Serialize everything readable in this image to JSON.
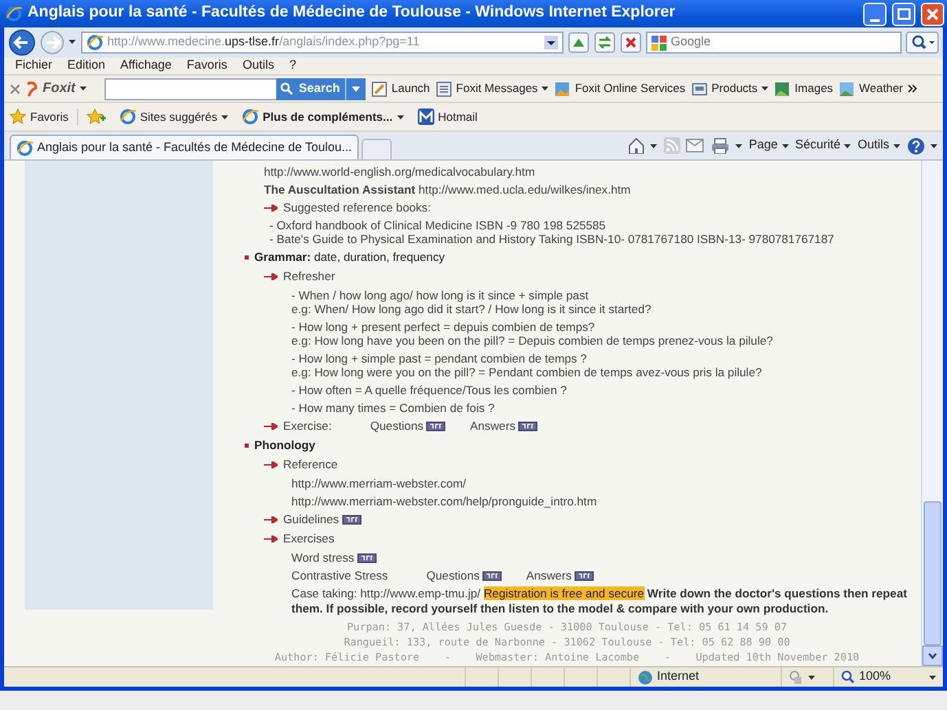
{
  "window": {
    "title": "Anglais pour la santé - Facultés de Médecine de Toulouse - Windows Internet Explorer"
  },
  "address": {
    "prefix": "http://www.medecine.",
    "host": "ups-tlse.fr",
    "path": "/anglais/index.php?pg=11"
  },
  "search": {
    "placeholder": "Google"
  },
  "menu": [
    "Fichier",
    "Edition",
    "Affichage",
    "Favoris",
    "Outils",
    "?"
  ],
  "foxit": {
    "brand": "Foxit",
    "button": "Search",
    "items": [
      {
        "label": "Launch",
        "dropdown": false
      },
      {
        "label": "Foxit Messages",
        "dropdown": true
      },
      {
        "label": "Foxit Online Services",
        "dropdown": false
      },
      {
        "label": "Products",
        "dropdown": true
      },
      {
        "label": "Images",
        "dropdown": false
      },
      {
        "label": "Weather",
        "dropdown": false
      }
    ]
  },
  "favorites": {
    "label": "Favoris",
    "items": [
      {
        "label": "Sites suggérés",
        "bold": false,
        "dropdown": true
      },
      {
        "label": "Plus de compléments...",
        "bold": true,
        "dropdown": true
      },
      {
        "label": "Hotmail",
        "bold": false,
        "dropdown": false
      }
    ]
  },
  "tabs": [
    {
      "label": "Anglais pour la santé - Facultés de Médecine de Toulou...",
      "selected": true
    }
  ],
  "commands": [
    "Page",
    "Sécurité",
    "Outils"
  ],
  "content": [
    {
      "kind": "group",
      "children": [
        {
          "kind": "text",
          "lines": [
            "http://www.world-english.org/medicalvocabulary.htm"
          ]
        },
        {
          "kind": "text",
          "lines": [
            "**The Auscultation Assistant** http://www.med.ucla.edu/wilkes/inex.htm"
          ]
        },
        {
          "kind": "arrow",
          "text": "Suggested reference books:",
          "children": [
            {
              "kind": "list",
              "lines": [
                "- Oxford handbook of Clinical Medicine ISBN -9 780 198 525585",
                "- Bate's Guide to Physical Examination and History Taking ISBN-10- 0781767180 ISBN-13- 9780781767187"
              ]
            }
          ]
        }
      ]
    },
    {
      "kind": "bullet",
      "text": "**Grammar:** date, duration, frequency",
      "children": [
        {
          "kind": "arrow",
          "text": "Refresher",
          "children": [
            {
              "kind": "text",
              "lines": [
                "- When / how long ago/ how long is it since + simple past",
                "e.g: When/ How long ago did it start? / How long is it since it started?"
              ]
            },
            {
              "kind": "text",
              "lines": [
                "- How long + present perfect = depuis combien de temps?",
                "e.g: How long have you been on the pill?   = Depuis combien de temps prenez-vous la pilule?"
              ]
            },
            {
              "kind": "text",
              "lines": [
                "- How long + simple past = pendant combien de temps ?",
                "e.g: How long were you on the pill?   = Pendant combien de temps avez-vous pris la pilule?"
              ]
            },
            {
              "kind": "text",
              "lines": [
                "- How often = A quelle fréquence/Tous les combien ?"
              ]
            },
            {
              "kind": "text",
              "lines": [
                "- How many times = Combien de fois ?"
              ]
            }
          ]
        },
        {
          "kind": "arrow",
          "text": "Exercise:",
          "links": [
            "Questions",
            "Answers"
          ]
        }
      ]
    },
    {
      "kind": "bullet",
      "text": "**Phonology**",
      "children": [
        {
          "kind": "arrow",
          "text": "Reference",
          "children": [
            {
              "kind": "text",
              "lines": [
                "http://www.merriam-webster.com/"
              ]
            },
            {
              "kind": "text",
              "lines": [
                "http://www.merriam-webster.com/help/pronguide_intro.htm"
              ]
            }
          ]
        },
        {
          "kind": "arrow",
          "links": [
            "Guidelines"
          ]
        },
        {
          "kind": "arrow",
          "text": "Exercises",
          "children": [
            {
              "kind": "text",
              "links": [
                "Word stress"
              ]
            },
            {
              "kind": "text",
              "text": "Contrastive Stress",
              "links": [
                "Questions",
                "Answers"
              ]
            },
            {
              "kind": "case",
              "text": "Case taking: http://www.emp-tmu.jp/",
              "highlight": "Registration is free and secure",
              "note": "Write down the doctor's questions then repeat them. If possible, record yourself then listen to the model & compare with your own production."
            }
          ]
        }
      ]
    }
  ],
  "footer": [
    "Purpan: 37, Allées Jules Guesde - 31000 Toulouse - Tel: 05 61 14 59 07",
    "Rangueil: 133, route de Narbonne - 31062 Toulouse - Tel: 05 62 88 90 00",
    "Author: Félicie Pastore    -    Webmaster: Antoine Lacombe    -    Updated 10th November 2010"
  ],
  "status": {
    "zone": "Internet",
    "zoom": "100%"
  }
}
